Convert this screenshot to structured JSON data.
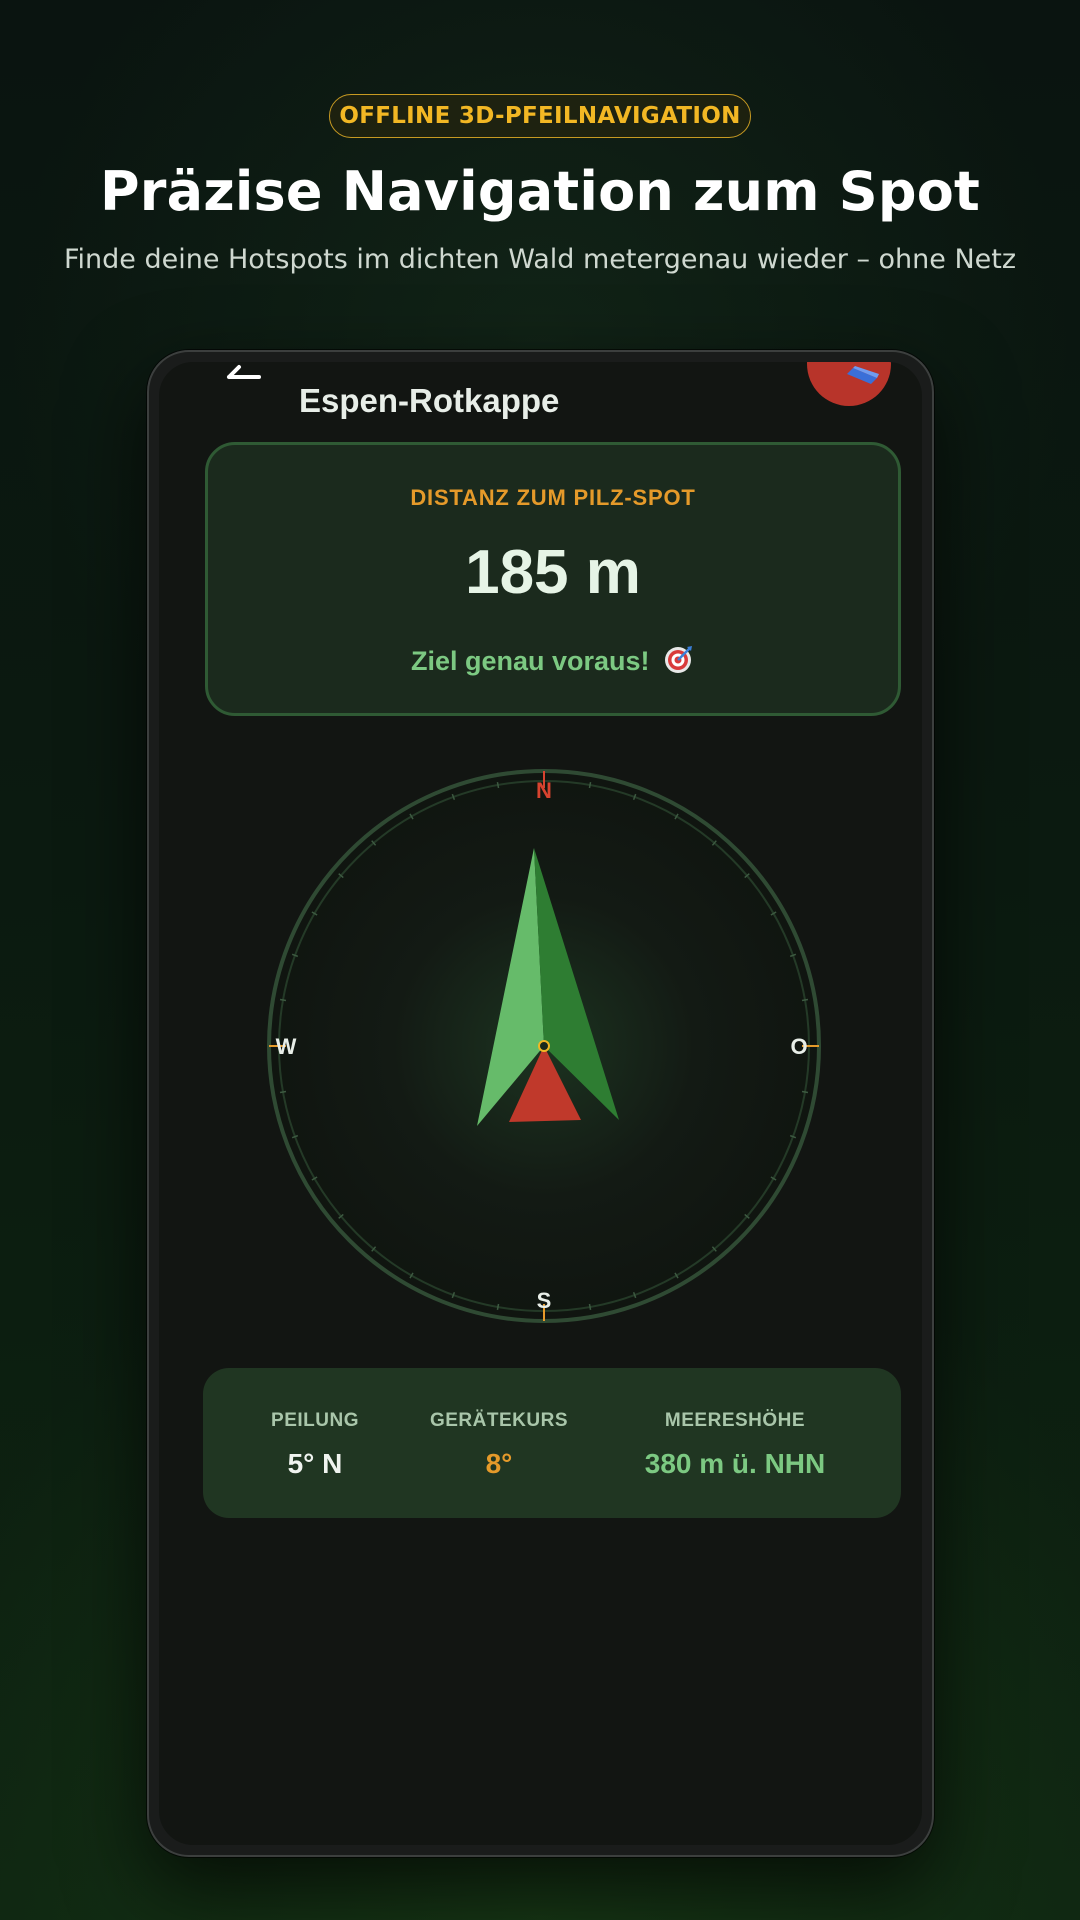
{
  "badge": "OFFLINE 3D-PFEILNAVIGATION",
  "headline": "Präzise Navigation zum Spot",
  "subline": "Finde deine Hotspots im dichten Wald metergenau wieder – ohne Netz",
  "app": {
    "title": "Espen-Rotkappe"
  },
  "distance": {
    "label": "DISTANZ ZUM PILZ-SPOT",
    "value": "185 m",
    "status": "Ziel genau voraus!",
    "status_icon": "target-icon"
  },
  "compass": {
    "north": "N",
    "east": "O",
    "south": "S",
    "west": "W",
    "north_color": "#d7432f",
    "arrow_color": "#4caf50"
  },
  "stats": [
    {
      "label": "PEILUNG",
      "value": "5° N"
    },
    {
      "label": "GERÄTEKURS",
      "value": "8°"
    },
    {
      "label": "MEERESHÖHE",
      "value": "380 m ü. NHN"
    }
  ],
  "colors": {
    "accent": "#f2b724",
    "orange": "#e59a2a",
    "green": "#7cc982",
    "background": "#0b1a10"
  }
}
